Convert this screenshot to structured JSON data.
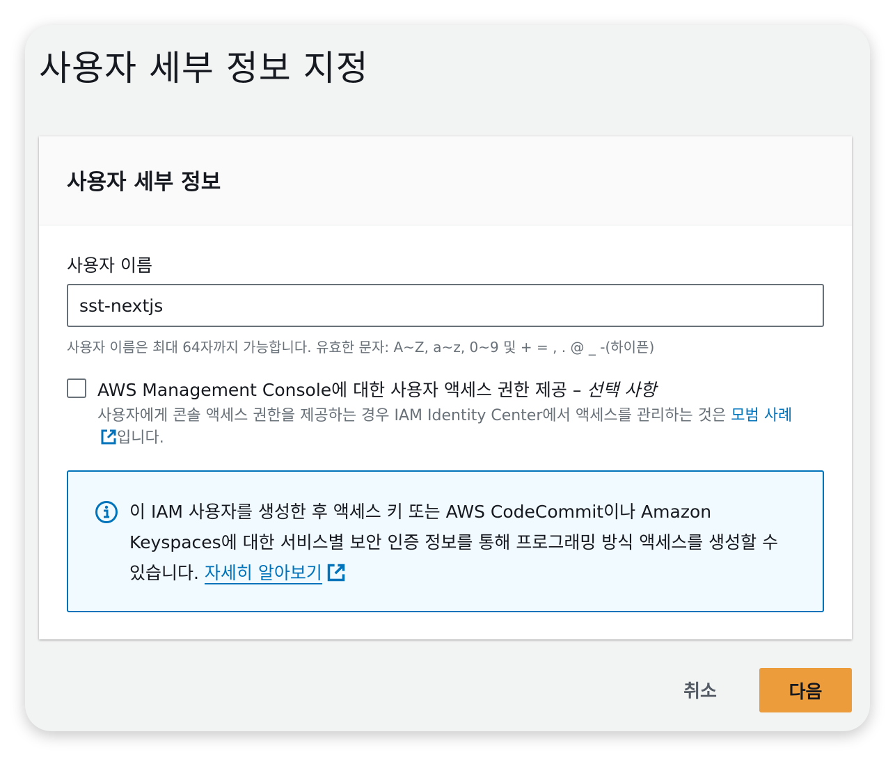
{
  "page": {
    "title": "사용자 세부 정보 지정"
  },
  "card": {
    "title": "사용자 세부 정보"
  },
  "username": {
    "label": "사용자 이름",
    "value": "sst-nextjs",
    "hint": "사용자 이름은 최대 64자까지 가능합니다. 유효한 문자: A~Z, a~z, 0~9 및 + = , . @ _ -(하이픈)"
  },
  "console_access": {
    "checked": false,
    "label": "AWS Management Console에 대한 사용자 액세스 권한 제공 – ",
    "optional": "선택 사항",
    "desc_before": "사용자에게 콘솔 액세스 권한을 제공하는 경우 IAM Identity Center에서 액세스를 관리하는 것은 ",
    "desc_link": "모범 사례",
    "desc_after": "입니다."
  },
  "info": {
    "text": "이 IAM 사용자를 생성한 후 액세스 키 또는 AWS CodeCommit이나 Amazon Keyspaces에 대한 서비스별 보안 인증 정보를 통해 프로그래밍 방식 액세스를 생성할 수 있습니다. ",
    "link": "자세히 알아보기"
  },
  "footer": {
    "cancel_label": "취소",
    "next_label": "다음",
    "primary_color": "#ec9c3b",
    "link_color": "#0073bb"
  },
  "icons": {
    "external": "external-link-icon",
    "info": "info-icon"
  }
}
